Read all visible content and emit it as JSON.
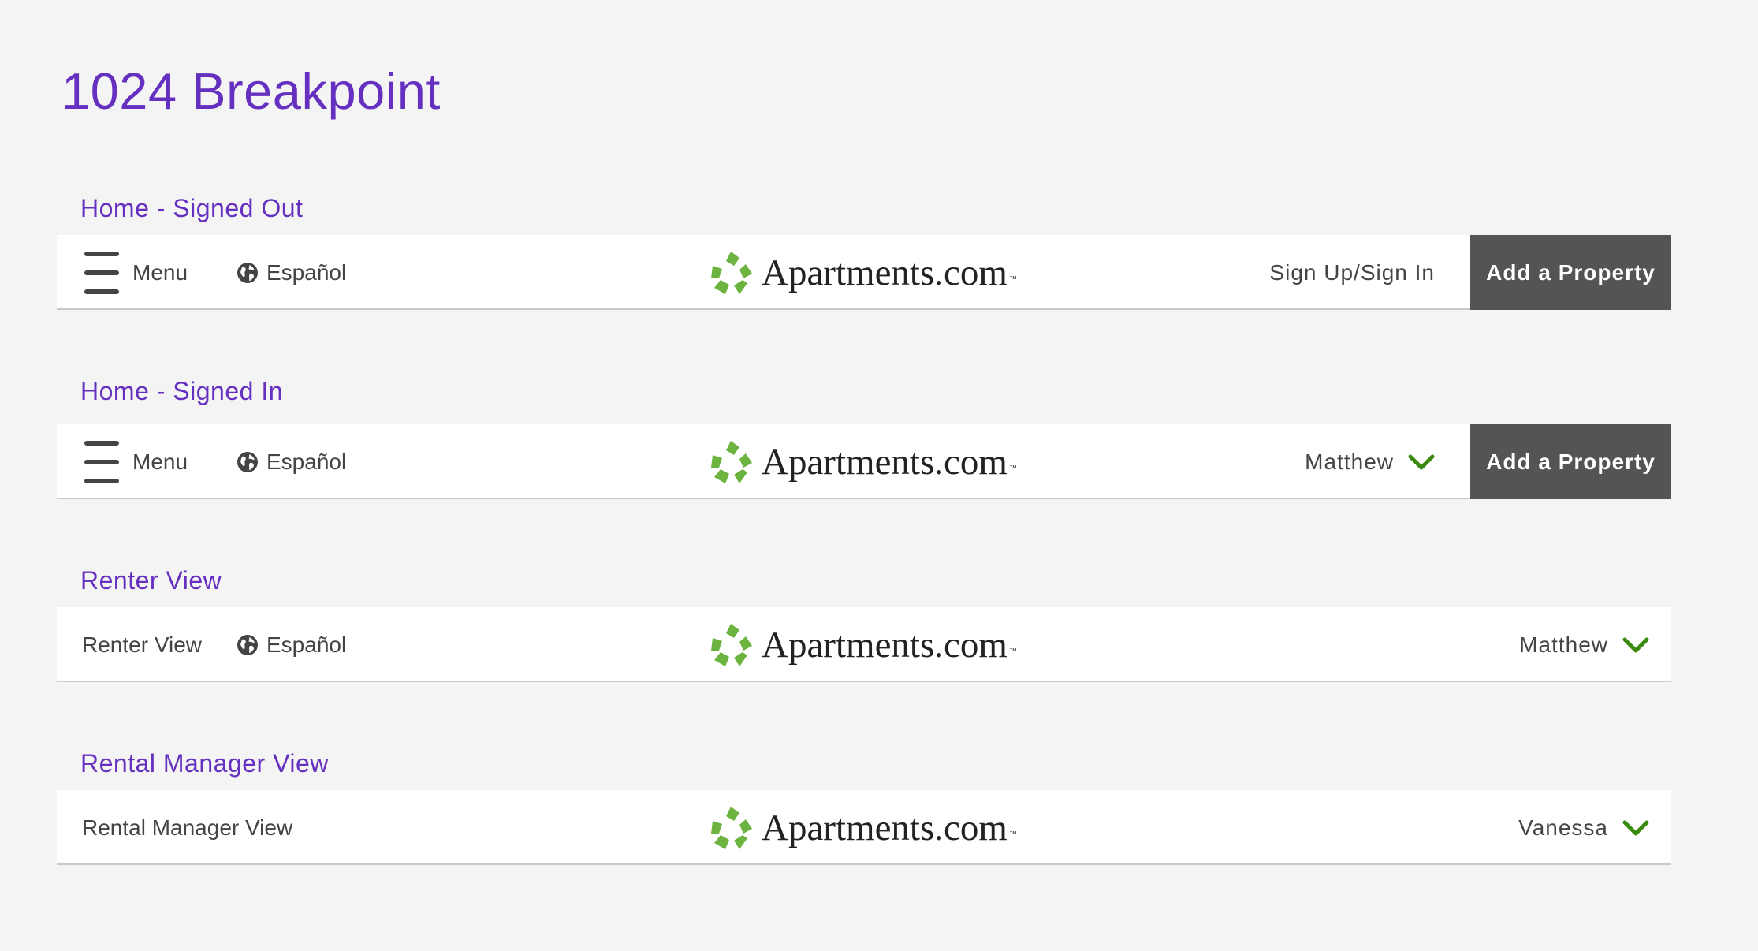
{
  "page": {
    "title": "1024 Breakpoint"
  },
  "colors": {
    "accent": "#6530c0",
    "logo_green": "#6cb33f",
    "chevron_green": "#3b8a10",
    "button_bg": "#545454"
  },
  "sections": [
    {
      "label": "Home - Signed Out",
      "menu_label": "Menu",
      "language_label": "Español",
      "logo_text": "Apartments.com",
      "logo_tm": "™",
      "right_label": "Sign Up/Sign In",
      "button_label": "Add a Property"
    },
    {
      "label": "Home - Signed In",
      "menu_label": "Menu",
      "language_label": "Español",
      "logo_text": "Apartments.com",
      "logo_tm": "™",
      "user_name": "Matthew",
      "button_label": "Add a Property"
    },
    {
      "label": "Renter View",
      "view_label": "Renter View",
      "language_label": "Español",
      "logo_text": "Apartments.com",
      "logo_tm": "™",
      "user_name": "Matthew"
    },
    {
      "label": "Rental Manager View",
      "view_label": "Rental Manager View",
      "logo_text": "Apartments.com",
      "logo_tm": "™",
      "user_name": "Vanessa"
    }
  ]
}
